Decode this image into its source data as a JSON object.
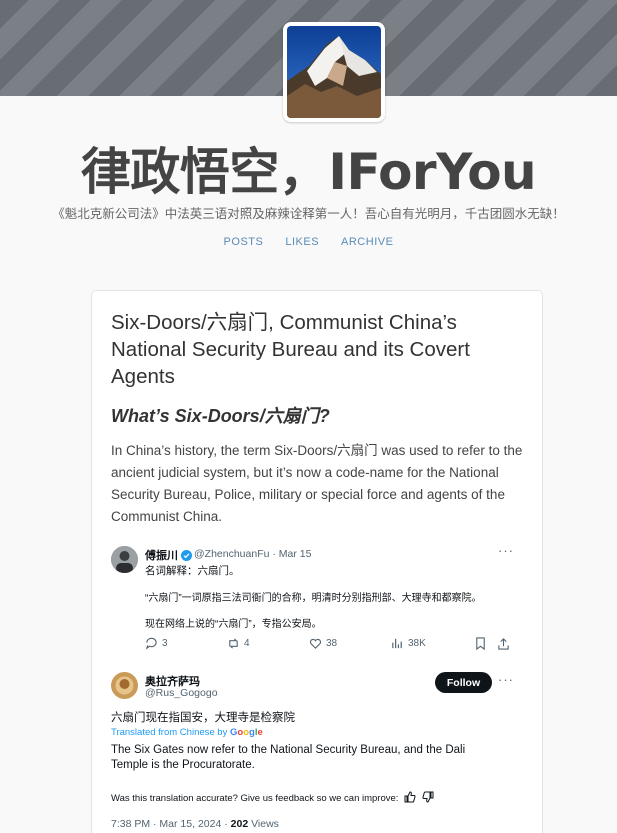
{
  "header": {
    "title": "律政悟空，IForYou",
    "description": "《魁北克新公司法》中法英三语对照及麻辣诠释第一人！吾心自有光明月，千古团圆水无缺！"
  },
  "nav": [
    "POSTS",
    "LIKES",
    "ARCHIVE"
  ],
  "post": {
    "title": "Six-Doors/六扇门, Communist China’s National Security Bureau and its Covert Agents",
    "subtitle": "What’s Six-Doors/六扇门?",
    "body": "In China’s history, the term Six-Doors/六扇门 was used to refer to the ancient judicial system, but it’s now a code-name for the National Security Bureau, Police, military or special force and agents of the Communist China."
  },
  "tweet1": {
    "name": "傅振川",
    "handle": "@ZhenchuanFu · Mar 15",
    "line1": "名词解释：六扇门。",
    "line2": "“六扇门”一词原指三法司衙门的合称，明清时分别指刑部、大理寺和都察院。",
    "line3": "现在网络上说的“六扇门”，专指公安局。",
    "replies": "3",
    "retweets": "4",
    "likes": "38",
    "views": "38K"
  },
  "tweet2": {
    "name": "奥拉齐萨玛",
    "handle": "@Rus_Gogogo",
    "follow": "Follow",
    "text": "六扇门现在指国安，大理寺是检察院",
    "translated_by": "Translated from Chinese by",
    "translation": "The Six Gates now refer to the National Security Bureau, and the Dali Temple is the Procuratorate.",
    "feedback": "Was this translation accurate? Give us feedback so we can improve:",
    "time": "7:38 PM · Mar 15, 2024 · ",
    "view_count": "202",
    "views_label": " Views"
  },
  "colors": {
    "accent": "#1d9bf0",
    "nav_link": "#5a8ab8",
    "banner": "#6e7279"
  }
}
